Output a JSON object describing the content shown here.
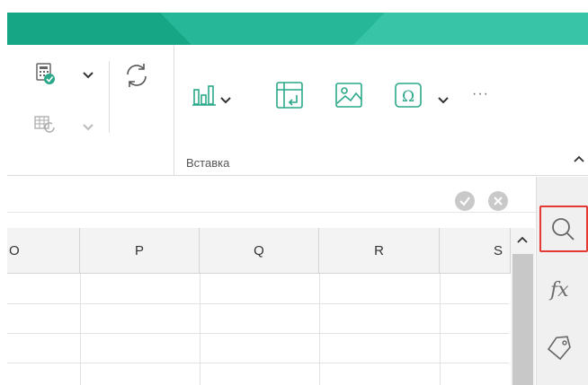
{
  "ribbon": {
    "group_label": "Вставка",
    "more_label": "···"
  },
  "sheet": {
    "columns": [
      "O",
      "P",
      "Q",
      "R",
      "S"
    ]
  },
  "side_panel": {
    "formula_label": "fx"
  },
  "colors": {
    "banner": "#21b596",
    "accent": "#2aa889",
    "active_outline": "#e53935"
  }
}
